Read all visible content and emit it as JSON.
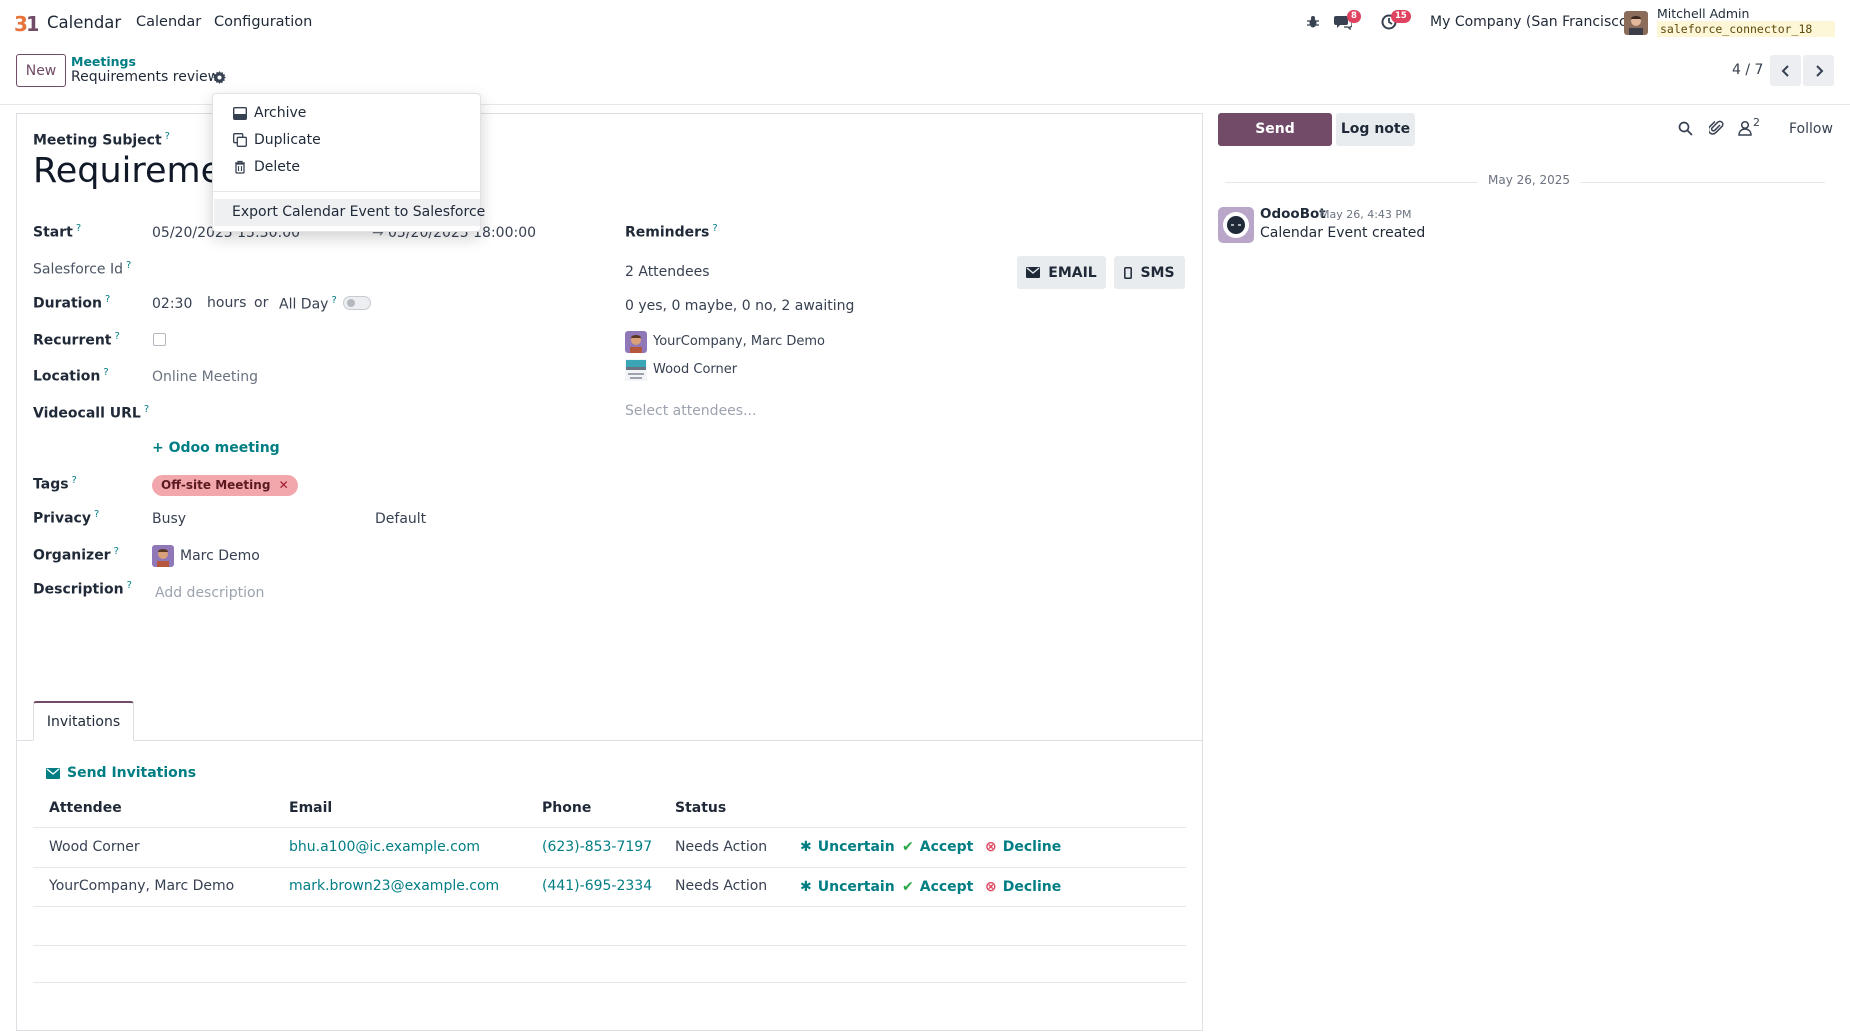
{
  "navbar": {
    "app_name": "Calendar",
    "menu": [
      "Calendar",
      "Configuration"
    ],
    "messages_count": "8",
    "activities_count": "15",
    "company": "My Company (San Francisco)",
    "user_name": "Mitchell Admin",
    "database": "saleforce_connector_18"
  },
  "control": {
    "new_label": "New",
    "breadcrumb_parent": "Meetings",
    "breadcrumb_current": "Requirements review",
    "pager": "4 / 7"
  },
  "dropdown": {
    "archive": "Archive",
    "duplicate": "Duplicate",
    "delete": "Delete",
    "export": "Export Calendar Event to Salesforce"
  },
  "form": {
    "subject_label": "Meeting Subject",
    "subject_value": "Requirements review",
    "start_label": "Start",
    "start_value": "05/20/2025 15:30:00",
    "end_value": "05/20/2025 18:00:00",
    "salesforce_label": "Salesforce Id",
    "duration_label": "Duration",
    "duration_value": "02:30",
    "hours_label": "hours",
    "or_label": "or",
    "allday_label": "All Day",
    "recurrent_label": "Recurrent",
    "location_label": "Location",
    "location_value": "Online Meeting",
    "videocall_label": "Videocall URL",
    "odoo_meeting": "Odoo meeting",
    "tags_label": "Tags",
    "tag_value": "Off-site Meeting",
    "privacy_label": "Privacy",
    "privacy_busy": "Busy",
    "privacy_default": "Default",
    "organizer_label": "Organizer",
    "organizer_value": "Marc Demo",
    "description_label": "Description",
    "description_placeholder": "Add description",
    "reminders_label": "Reminders",
    "attendees_count": "2 Attendees",
    "email_btn": "EMAIL",
    "sms_btn": "SMS",
    "attendees_summary": "0 yes, 0 maybe, 0 no, 2 awaiting",
    "attendees": [
      "YourCompany, Marc Demo",
      "Wood Corner"
    ],
    "select_attendees_placeholder": "Select attendees..."
  },
  "invitations": {
    "tab_label": "Invitations",
    "send_label": "Send Invitations",
    "columns": [
      "Attendee",
      "Email",
      "Phone",
      "Status"
    ],
    "rows": [
      {
        "attendee": "Wood Corner",
        "email": "bhu.a100@ic.example.com",
        "phone": "(623)-853-7197",
        "status": "Needs Action"
      },
      {
        "attendee": "YourCompany, Marc Demo",
        "email": "mark.brown23@example.com",
        "phone": "(441)-695-2334",
        "status": "Needs Action"
      }
    ],
    "actions": {
      "uncertain": "Uncertain",
      "accept": "Accept",
      "decline": "Decline"
    }
  },
  "chatter": {
    "send_message": "Send message",
    "log_note": "Log note",
    "followers_count": "2",
    "follow": "Follow",
    "date_separator": "May 26, 2025",
    "message": {
      "author": "OdooBot",
      "date": "May 26, 4:43 PM",
      "body": "Calendar Event created"
    }
  },
  "colors": {
    "brand": "#714b67",
    "link": "#017e84",
    "badge": "#e0435f",
    "tag": "#f1a7ab"
  }
}
